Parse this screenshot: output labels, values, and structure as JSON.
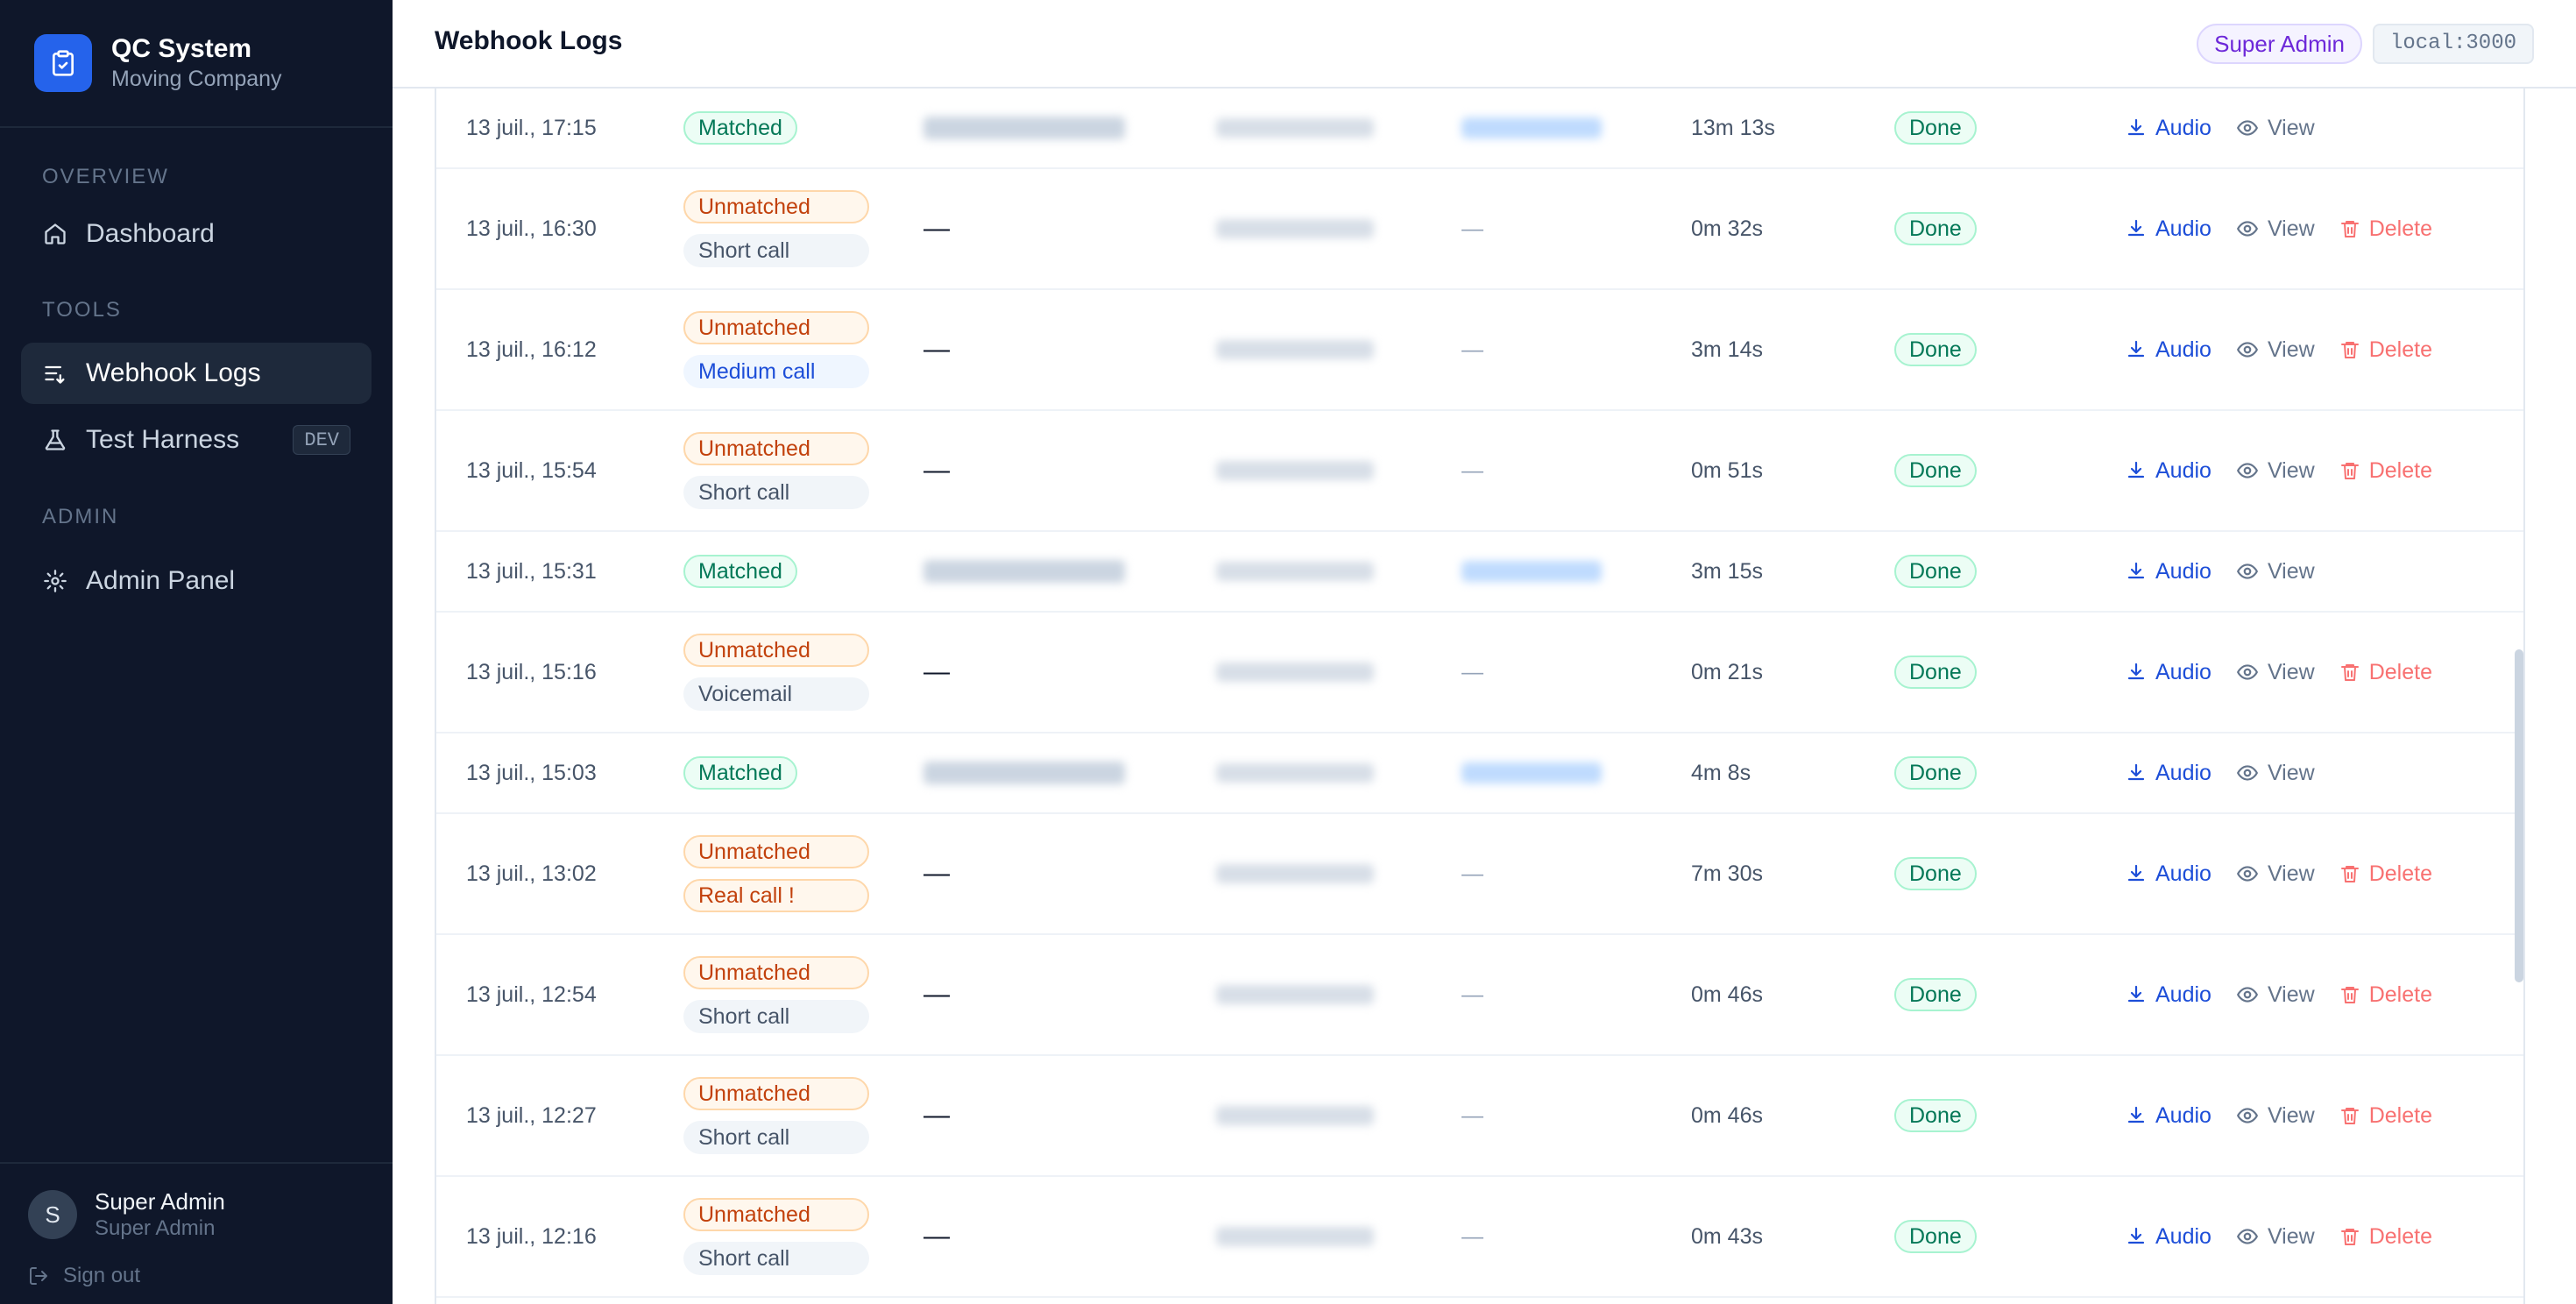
{
  "app": {
    "title": "QC System",
    "subtitle": "Moving Company"
  },
  "sidebar": {
    "sections": [
      {
        "label": "OVERVIEW"
      },
      {
        "label": "TOOLS"
      },
      {
        "label": "ADMIN"
      }
    ],
    "items": [
      {
        "label": "Dashboard",
        "icon": "home-icon"
      },
      {
        "label": "Webhook Logs",
        "icon": "list-icon",
        "active": true
      },
      {
        "label": "Test Harness",
        "icon": "flask-icon",
        "badge": "DEV"
      },
      {
        "label": "Admin Panel",
        "icon": "gear-icon"
      }
    ],
    "user": {
      "initial": "S",
      "name": "Super Admin",
      "role": "Super Admin",
      "signout": "Sign out"
    }
  },
  "header": {
    "title": "Webhook Logs",
    "role_badge": "Super Admin",
    "host": "local:3000"
  },
  "actions": {
    "audio": "Audio",
    "view": "View",
    "delete": "Delete"
  },
  "colors": {
    "sidebar_bg": "#0f172a",
    "accent": "#2563eb",
    "matched": "#047857",
    "unmatched": "#c2410c",
    "delete": "#f87171"
  },
  "rows": [
    {
      "date": "13 juil., 17:15",
      "tags": [
        "Matched"
      ],
      "name": "",
      "rep": "",
      "duration": "13m 13s",
      "status": "Done",
      "deletable": false
    },
    {
      "date": "13 juil., 16:30",
      "tags": [
        "Unmatched",
        "Short call"
      ],
      "name": "—",
      "rep": "—",
      "duration": "0m 32s",
      "status": "Done",
      "deletable": true
    },
    {
      "date": "13 juil., 16:12",
      "tags": [
        "Unmatched",
        "Medium call"
      ],
      "name": "—",
      "rep": "—",
      "duration": "3m 14s",
      "status": "Done",
      "deletable": true
    },
    {
      "date": "13 juil., 15:54",
      "tags": [
        "Unmatched",
        "Short call"
      ],
      "name": "—",
      "rep": "—",
      "duration": "0m 51s",
      "status": "Done",
      "deletable": true
    },
    {
      "date": "13 juil., 15:31",
      "tags": [
        "Matched"
      ],
      "name": "",
      "rep": "",
      "duration": "3m 15s",
      "status": "Done",
      "deletable": false
    },
    {
      "date": "13 juil., 15:16",
      "tags": [
        "Unmatched",
        "Voicemail"
      ],
      "name": "—",
      "rep": "—",
      "duration": "0m 21s",
      "status": "Done",
      "deletable": true
    },
    {
      "date": "13 juil., 15:03",
      "tags": [
        "Matched"
      ],
      "name": "",
      "rep": "",
      "duration": "4m 8s",
      "status": "Done",
      "deletable": false
    },
    {
      "date": "13 juil., 13:02",
      "tags": [
        "Unmatched",
        "Real call !"
      ],
      "name": "—",
      "rep": "—",
      "duration": "7m 30s",
      "status": "Done",
      "deletable": true
    },
    {
      "date": "13 juil., 12:54",
      "tags": [
        "Unmatched",
        "Short call"
      ],
      "name": "—",
      "rep": "—",
      "duration": "0m 46s",
      "status": "Done",
      "deletable": true
    },
    {
      "date": "13 juil., 12:27",
      "tags": [
        "Unmatched",
        "Short call"
      ],
      "name": "—",
      "rep": "—",
      "duration": "0m 46s",
      "status": "Done",
      "deletable": true
    },
    {
      "date": "13 juil., 12:16",
      "tags": [
        "Unmatched",
        "Short call"
      ],
      "name": "—",
      "rep": "—",
      "duration": "0m 43s",
      "status": "Done",
      "deletable": true
    }
  ]
}
